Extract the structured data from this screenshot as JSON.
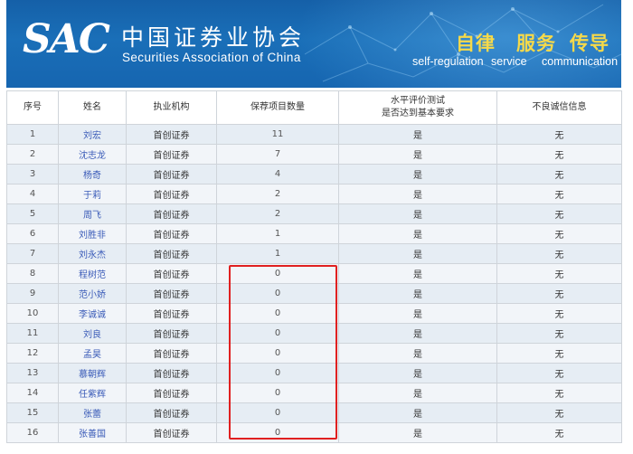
{
  "banner": {
    "logo_mark": "SAC",
    "org_name_cn": "中国证券业协会",
    "org_name_en": "Securities Association of China",
    "slogans": [
      {
        "cn": "自律",
        "en": "self-regulation"
      },
      {
        "cn": "服务",
        "en": "service"
      },
      {
        "cn": "传导",
        "en": "communication"
      }
    ],
    "colors": {
      "background": "#1a6fb8",
      "slogan": "#f5d94a"
    }
  },
  "table": {
    "headers": {
      "index": "序号",
      "name": "姓名",
      "institution": "执业机构",
      "sponsor_count": "保荐项目数量",
      "level_test_line1": "水平评价测试",
      "level_test_line2": "是否达到基本要求",
      "integrity": "不良诚信信息"
    },
    "rows": [
      {
        "index": "1",
        "name": "刘宏",
        "institution": "首创证券",
        "sponsor_count": "11",
        "level_test": "是",
        "integrity": "无"
      },
      {
        "index": "2",
        "name": "沈志龙",
        "institution": "首创证券",
        "sponsor_count": "7",
        "level_test": "是",
        "integrity": "无"
      },
      {
        "index": "3",
        "name": "杨奇",
        "institution": "首创证券",
        "sponsor_count": "4",
        "level_test": "是",
        "integrity": "无"
      },
      {
        "index": "4",
        "name": "于莉",
        "institution": "首创证券",
        "sponsor_count": "2",
        "level_test": "是",
        "integrity": "无"
      },
      {
        "index": "5",
        "name": "周飞",
        "institution": "首创证券",
        "sponsor_count": "2",
        "level_test": "是",
        "integrity": "无"
      },
      {
        "index": "6",
        "name": "刘胜非",
        "institution": "首创证券",
        "sponsor_count": "1",
        "level_test": "是",
        "integrity": "无"
      },
      {
        "index": "7",
        "name": "刘永杰",
        "institution": "首创证券",
        "sponsor_count": "1",
        "level_test": "是",
        "integrity": "无"
      },
      {
        "index": "8",
        "name": "程树范",
        "institution": "首创证券",
        "sponsor_count": "0",
        "level_test": "是",
        "integrity": "无"
      },
      {
        "index": "9",
        "name": "范小娇",
        "institution": "首创证券",
        "sponsor_count": "0",
        "level_test": "是",
        "integrity": "无"
      },
      {
        "index": "10",
        "name": "李诚诚",
        "institution": "首创证券",
        "sponsor_count": "0",
        "level_test": "是",
        "integrity": "无"
      },
      {
        "index": "11",
        "name": "刘良",
        "institution": "首创证券",
        "sponsor_count": "0",
        "level_test": "是",
        "integrity": "无"
      },
      {
        "index": "12",
        "name": "孟昊",
        "institution": "首创证券",
        "sponsor_count": "0",
        "level_test": "是",
        "integrity": "无"
      },
      {
        "index": "13",
        "name": "慕朝辉",
        "institution": "首创证券",
        "sponsor_count": "0",
        "level_test": "是",
        "integrity": "无"
      },
      {
        "index": "14",
        "name": "任紫辉",
        "institution": "首创证券",
        "sponsor_count": "0",
        "level_test": "是",
        "integrity": "无"
      },
      {
        "index": "15",
        "name": "张蕾",
        "institution": "首创证券",
        "sponsor_count": "0",
        "level_test": "是",
        "integrity": "无"
      },
      {
        "index": "16",
        "name": "张善国",
        "institution": "首创证券",
        "sponsor_count": "0",
        "level_test": "是",
        "integrity": "无"
      }
    ],
    "colors": {
      "name_link": "#3a5bb8",
      "highlight_box": "#e02020",
      "row_alt": "#e6edf4"
    }
  }
}
